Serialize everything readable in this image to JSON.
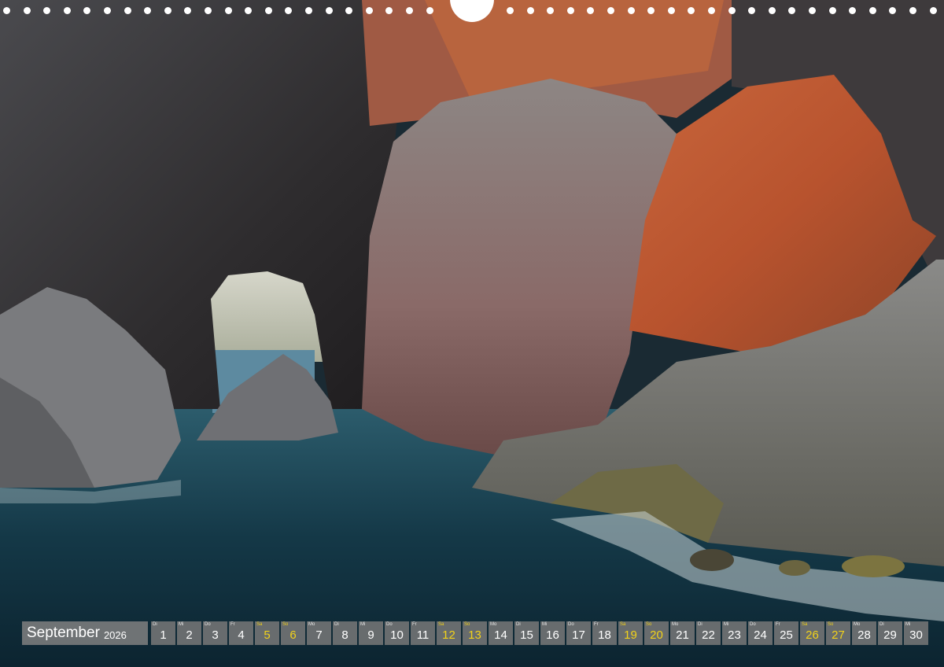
{
  "calendar": {
    "month": "September",
    "year": "2026",
    "weekend_color": "#f2d21a",
    "days": [
      {
        "wd": "Di",
        "num": "1",
        "weekend": false
      },
      {
        "wd": "Mi",
        "num": "2",
        "weekend": false
      },
      {
        "wd": "Do",
        "num": "3",
        "weekend": false
      },
      {
        "wd": "Fr",
        "num": "4",
        "weekend": false
      },
      {
        "wd": "Sa",
        "num": "5",
        "weekend": true
      },
      {
        "wd": "So",
        "num": "6",
        "weekend": true
      },
      {
        "wd": "Mo",
        "num": "7",
        "weekend": false
      },
      {
        "wd": "Di",
        "num": "8",
        "weekend": false
      },
      {
        "wd": "Mi",
        "num": "9",
        "weekend": false
      },
      {
        "wd": "Do",
        "num": "10",
        "weekend": false
      },
      {
        "wd": "Fr",
        "num": "11",
        "weekend": false
      },
      {
        "wd": "Sa",
        "num": "12",
        "weekend": true
      },
      {
        "wd": "So",
        "num": "13",
        "weekend": true
      },
      {
        "wd": "Mo",
        "num": "14",
        "weekend": false
      },
      {
        "wd": "Di",
        "num": "15",
        "weekend": false
      },
      {
        "wd": "Mi",
        "num": "16",
        "weekend": false
      },
      {
        "wd": "Do",
        "num": "17",
        "weekend": false
      },
      {
        "wd": "Fr",
        "num": "18",
        "weekend": false
      },
      {
        "wd": "Sa",
        "num": "19",
        "weekend": true
      },
      {
        "wd": "So",
        "num": "20",
        "weekend": true
      },
      {
        "wd": "Mo",
        "num": "21",
        "weekend": false
      },
      {
        "wd": "Di",
        "num": "22",
        "weekend": false
      },
      {
        "wd": "Mi",
        "num": "23",
        "weekend": false
      },
      {
        "wd": "Do",
        "num": "24",
        "weekend": false
      },
      {
        "wd": "Fr",
        "num": "25",
        "weekend": false
      },
      {
        "wd": "Sa",
        "num": "26",
        "weekend": true
      },
      {
        "wd": "So",
        "num": "27",
        "weekend": true
      },
      {
        "wd": "Mo",
        "num": "28",
        "weekend": false
      },
      {
        "wd": "Di",
        "num": "29",
        "weekend": false
      },
      {
        "wd": "Mi",
        "num": "30",
        "weekend": false
      }
    ]
  }
}
